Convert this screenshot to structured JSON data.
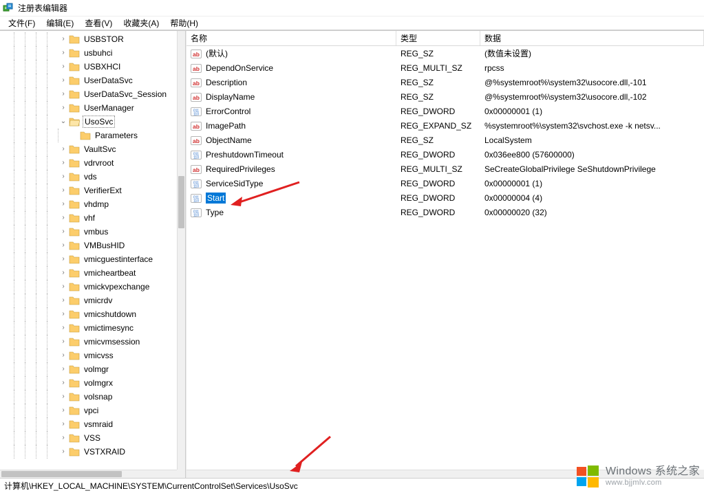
{
  "window": {
    "title": "注册表编辑器"
  },
  "menu": {
    "file": "文件(F)",
    "edit": "编辑(E)",
    "view": "查看(V)",
    "favorites": "收藏夹(A)",
    "help": "帮助(H)"
  },
  "tree": {
    "selected": "UsoSvc",
    "selected_child": "Parameters",
    "items": [
      {
        "indent": 5,
        "exp": "›",
        "label": "USBSTOR"
      },
      {
        "indent": 5,
        "exp": "›",
        "label": "usbuhci"
      },
      {
        "indent": 5,
        "exp": "›",
        "label": "USBXHCI"
      },
      {
        "indent": 5,
        "exp": "›",
        "label": "UserDataSvc"
      },
      {
        "indent": 5,
        "exp": "›",
        "label": "UserDataSvc_Session"
      },
      {
        "indent": 5,
        "exp": "›",
        "label": "UserManager"
      },
      {
        "indent": 5,
        "exp": "v",
        "label": "UsoSvc",
        "selected": true,
        "open": true
      },
      {
        "indent": 6,
        "exp": " ",
        "label": "Parameters"
      },
      {
        "indent": 5,
        "exp": "›",
        "label": "VaultSvc"
      },
      {
        "indent": 5,
        "exp": "›",
        "label": "vdrvroot"
      },
      {
        "indent": 5,
        "exp": "›",
        "label": "vds"
      },
      {
        "indent": 5,
        "exp": "›",
        "label": "VerifierExt"
      },
      {
        "indent": 5,
        "exp": "›",
        "label": "vhdmp"
      },
      {
        "indent": 5,
        "exp": "›",
        "label": "vhf"
      },
      {
        "indent": 5,
        "exp": "›",
        "label": "vmbus"
      },
      {
        "indent": 5,
        "exp": "›",
        "label": "VMBusHID"
      },
      {
        "indent": 5,
        "exp": "›",
        "label": "vmicguestinterface"
      },
      {
        "indent": 5,
        "exp": "›",
        "label": "vmicheartbeat"
      },
      {
        "indent": 5,
        "exp": "›",
        "label": "vmickvpexchange"
      },
      {
        "indent": 5,
        "exp": "›",
        "label": "vmicrdv"
      },
      {
        "indent": 5,
        "exp": "›",
        "label": "vmicshutdown"
      },
      {
        "indent": 5,
        "exp": "›",
        "label": "vmictimesync"
      },
      {
        "indent": 5,
        "exp": "›",
        "label": "vmicvmsession"
      },
      {
        "indent": 5,
        "exp": "›",
        "label": "vmicvss"
      },
      {
        "indent": 5,
        "exp": "›",
        "label": "volmgr"
      },
      {
        "indent": 5,
        "exp": "›",
        "label": "volmgrx"
      },
      {
        "indent": 5,
        "exp": "›",
        "label": "volsnap"
      },
      {
        "indent": 5,
        "exp": "›",
        "label": "vpci"
      },
      {
        "indent": 5,
        "exp": "›",
        "label": "vsmraid"
      },
      {
        "indent": 5,
        "exp": "›",
        "label": "VSS"
      },
      {
        "indent": 5,
        "exp": "›",
        "label": "VSTXRAID"
      }
    ]
  },
  "list": {
    "headers": {
      "name": "名称",
      "type": "类型",
      "data": "数据"
    },
    "rows": [
      {
        "icon": "str",
        "name": "(默认)",
        "type": "REG_SZ",
        "data": "(数值未设置)"
      },
      {
        "icon": "str",
        "name": "DependOnService",
        "type": "REG_MULTI_SZ",
        "data": "rpcss"
      },
      {
        "icon": "str",
        "name": "Description",
        "type": "REG_SZ",
        "data": "@%systemroot%\\system32\\usocore.dll,-101"
      },
      {
        "icon": "str",
        "name": "DisplayName",
        "type": "REG_SZ",
        "data": "@%systemroot%\\system32\\usocore.dll,-102"
      },
      {
        "icon": "bin",
        "name": "ErrorControl",
        "type": "REG_DWORD",
        "data": "0x00000001 (1)"
      },
      {
        "icon": "str",
        "name": "ImagePath",
        "type": "REG_EXPAND_SZ",
        "data": "%systemroot%\\system32\\svchost.exe -k netsv..."
      },
      {
        "icon": "str",
        "name": "ObjectName",
        "type": "REG_SZ",
        "data": "LocalSystem"
      },
      {
        "icon": "bin",
        "name": "PreshutdownTimeout",
        "type": "REG_DWORD",
        "data": "0x036ee800 (57600000)"
      },
      {
        "icon": "str",
        "name": "RequiredPrivileges",
        "type": "REG_MULTI_SZ",
        "data": "SeCreateGlobalPrivilege SeShutdownPrivilege"
      },
      {
        "icon": "bin",
        "name": "ServiceSidType",
        "type": "REG_DWORD",
        "data": "0x00000001 (1)"
      },
      {
        "icon": "bin",
        "name": "Start",
        "type": "REG_DWORD",
        "data": "0x00000004 (4)",
        "selected": true
      },
      {
        "icon": "bin",
        "name": "Type",
        "type": "REG_DWORD",
        "data": "0x00000020 (32)"
      }
    ]
  },
  "status": {
    "path": "计算机\\HKEY_LOCAL_MACHINE\\SYSTEM\\CurrentControlSet\\Services\\UsoSvc"
  },
  "watermark": {
    "brand": "Windows",
    "line1_tail": "系统之家",
    "line2": "www.bjjmlv.com"
  }
}
